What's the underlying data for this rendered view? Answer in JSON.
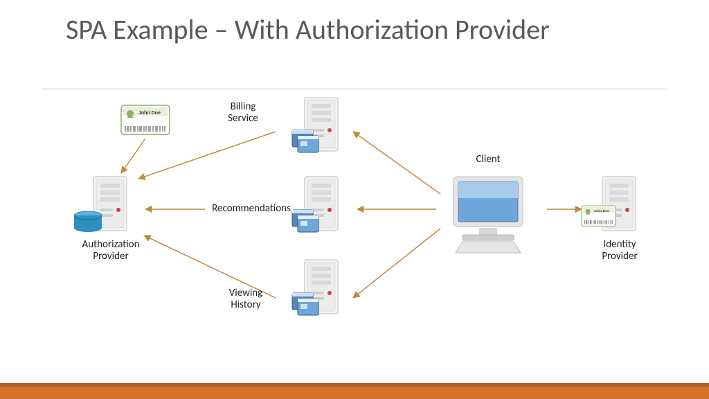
{
  "title": "SPA Example – With Authorization Provider",
  "nodes": {
    "auth_provider": "Authorization\nProvider",
    "billing": "Billing\nService",
    "recommendations": "Recommendations",
    "viewing": "Viewing\nHistory",
    "client": "Client",
    "identity": "Identity\nProvider",
    "id_card_name": "John Doe"
  },
  "colors": {
    "accent_footer": "#d7722c",
    "accent_footer_dark": "#b35f25",
    "arrow": "#c08a3e",
    "monitor_screen": "#6fa6d9",
    "db": "#2f8fbf"
  },
  "arrows": [
    {
      "from": "client",
      "to": "billing"
    },
    {
      "from": "client",
      "to": "recommendations"
    },
    {
      "from": "client",
      "to": "viewing"
    },
    {
      "from": "client",
      "to": "identity"
    },
    {
      "from": "billing",
      "to": "auth_provider"
    },
    {
      "from": "recommendations",
      "to": "auth_provider"
    },
    {
      "from": "viewing",
      "to": "auth_provider"
    },
    {
      "from": "id_card",
      "to": "auth_provider"
    }
  ]
}
